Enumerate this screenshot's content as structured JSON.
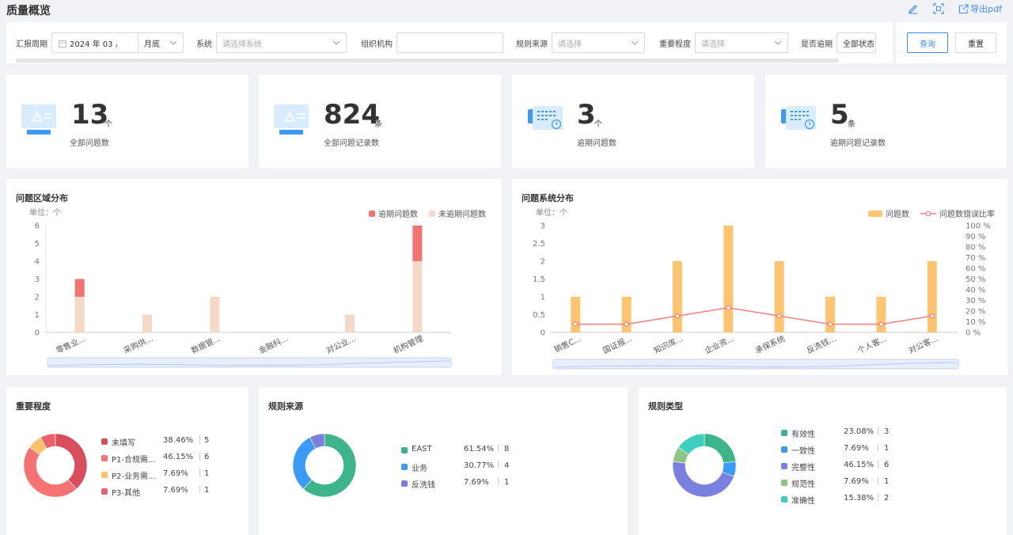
{
  "header": {
    "title": "质量概览",
    "export_label": "导出pdf",
    "edit_icon": "edit-icon",
    "fullscreen_icon": "fullscreen-icon",
    "export_icon": "export-icon"
  },
  "filters": {
    "period": {
      "label": "汇报周期",
      "value": "2024 年 03 月",
      "freq": "月底"
    },
    "system": {
      "label": "系统",
      "placeholder": "请选择系统"
    },
    "org": {
      "label": "组织机构",
      "value": ""
    },
    "rule_source": {
      "label": "规则来源",
      "placeholder": "请选择"
    },
    "importance": {
      "label": "重要程度",
      "placeholder": "请选择"
    },
    "overdue": {
      "label": "是否逾期",
      "value": "全部状态"
    }
  },
  "actions": {
    "query": "查询",
    "reset": "重置"
  },
  "stats": [
    {
      "value": "13",
      "unit": "个",
      "label": "全部问题数",
      "icon": "warning-monitor-icon"
    },
    {
      "value": "824",
      "unit": "条",
      "label": "全部问题记录数",
      "icon": "warning-monitor-icon"
    },
    {
      "value": "3",
      "unit": "个",
      "label": "逾期问题数",
      "icon": "calendar-clock-icon"
    },
    {
      "value": "5",
      "unit": "条",
      "label": "逾期问题记录数",
      "icon": "calendar-clock-icon"
    }
  ],
  "colors": {
    "overdue": "#f47272",
    "not_overdue": "#f5d9c8",
    "issue_bar": "#fdc570",
    "error_line": "#f08080",
    "accent": "#3b8df5"
  },
  "charts": {
    "region": {
      "title": "问题区域分布",
      "unit": "单位：个",
      "chart_data": {
        "type": "bar",
        "stacked": true,
        "categories": [
          "零售业...",
          "采购供...",
          "数据管...",
          "金融科...",
          "对公业...",
          "机构管理"
        ],
        "series": [
          {
            "name": "逾期问题数",
            "values": [
              1,
              0,
              0,
              0,
              0,
              2
            ]
          },
          {
            "name": "未逾期问题数",
            "values": [
              2,
              1,
              2,
              0,
              1,
              4
            ]
          }
        ],
        "ylim": [
          0,
          6
        ],
        "yticks": [
          0,
          1,
          2,
          3,
          4,
          5,
          6
        ],
        "legend": "top-right",
        "grid": false
      }
    },
    "system": {
      "title": "问题系统分布",
      "unit": "单位：个",
      "chart_data": {
        "type": "bar",
        "categories": [
          "销售C...",
          "国证报...",
          "知识库...",
          "企业资...",
          "承保系统",
          "反洗钱...",
          "个人客...",
          "对公客..."
        ],
        "series": [
          {
            "name": "问题数",
            "type": "bar",
            "values": [
              1,
              1,
              2,
              3,
              2,
              1,
              1,
              2
            ]
          },
          {
            "name": "问题数错误比率",
            "type": "line",
            "axis": "right",
            "values": [
              7.69,
              7.69,
              15.38,
              23.08,
              15.38,
              7.69,
              7.69,
              15.38
            ]
          }
        ],
        "ylim": [
          0,
          3
        ],
        "yticks": [
          "0",
          "0.5",
          "1",
          "1.5",
          "2",
          "2.5",
          "3"
        ],
        "y2lim": [
          0,
          100
        ],
        "y2ticks": [
          "0 %",
          "10 %",
          "20 %",
          "30 %",
          "40 %",
          "50 %",
          "60 %",
          "70 %",
          "80 %",
          "90 %",
          "100 %"
        ],
        "legend": "top-right",
        "grid": false
      }
    },
    "importance": {
      "title": "重要程度",
      "chart_data": {
        "type": "pie",
        "donut": true,
        "slices": [
          {
            "name": "未填写",
            "percent": "38.46%",
            "count": "5",
            "value": 5,
            "color": "#d94e5d"
          },
          {
            "name": "P1-合规需...",
            "percent": "46.15%",
            "count": "6",
            "value": 6,
            "color": "#f47272"
          },
          {
            "name": "P2-业务需...",
            "percent": "7.69%",
            "count": "1",
            "value": 1,
            "color": "#fbc26c"
          },
          {
            "name": "P3-其他",
            "percent": "7.69%",
            "count": "1",
            "value": 1,
            "color": "#e8626d"
          }
        ]
      }
    },
    "source": {
      "title": "规则来源",
      "chart_data": {
        "type": "pie",
        "donut": true,
        "slices": [
          {
            "name": "EAST",
            "percent": "61.54%",
            "count": "8",
            "value": 8,
            "color": "#3db48a"
          },
          {
            "name": "业务",
            "percent": "30.77%",
            "count": "4",
            "value": 4,
            "color": "#3b9af5"
          },
          {
            "name": "反洗钱",
            "percent": "7.69%",
            "count": "1",
            "value": 1,
            "color": "#7a7fe0"
          }
        ]
      }
    },
    "rule_type": {
      "title": "规则类型",
      "chart_data": {
        "type": "pie",
        "donut": true,
        "slices": [
          {
            "name": "有效性",
            "percent": "23.08%",
            "count": "3",
            "value": 3,
            "color": "#3db48a"
          },
          {
            "name": "一致性",
            "percent": "7.69%",
            "count": "1",
            "value": 1,
            "color": "#3b9af5"
          },
          {
            "name": "完整性",
            "percent": "46.15%",
            "count": "6",
            "value": 6,
            "color": "#7a7fe0"
          },
          {
            "name": "规范性",
            "percent": "7.69%",
            "count": "1",
            "value": 1,
            "color": "#8cc584"
          },
          {
            "name": "准确性",
            "percent": "15.38%",
            "count": "2",
            "value": 2,
            "color": "#3fcfc0"
          }
        ]
      }
    }
  }
}
